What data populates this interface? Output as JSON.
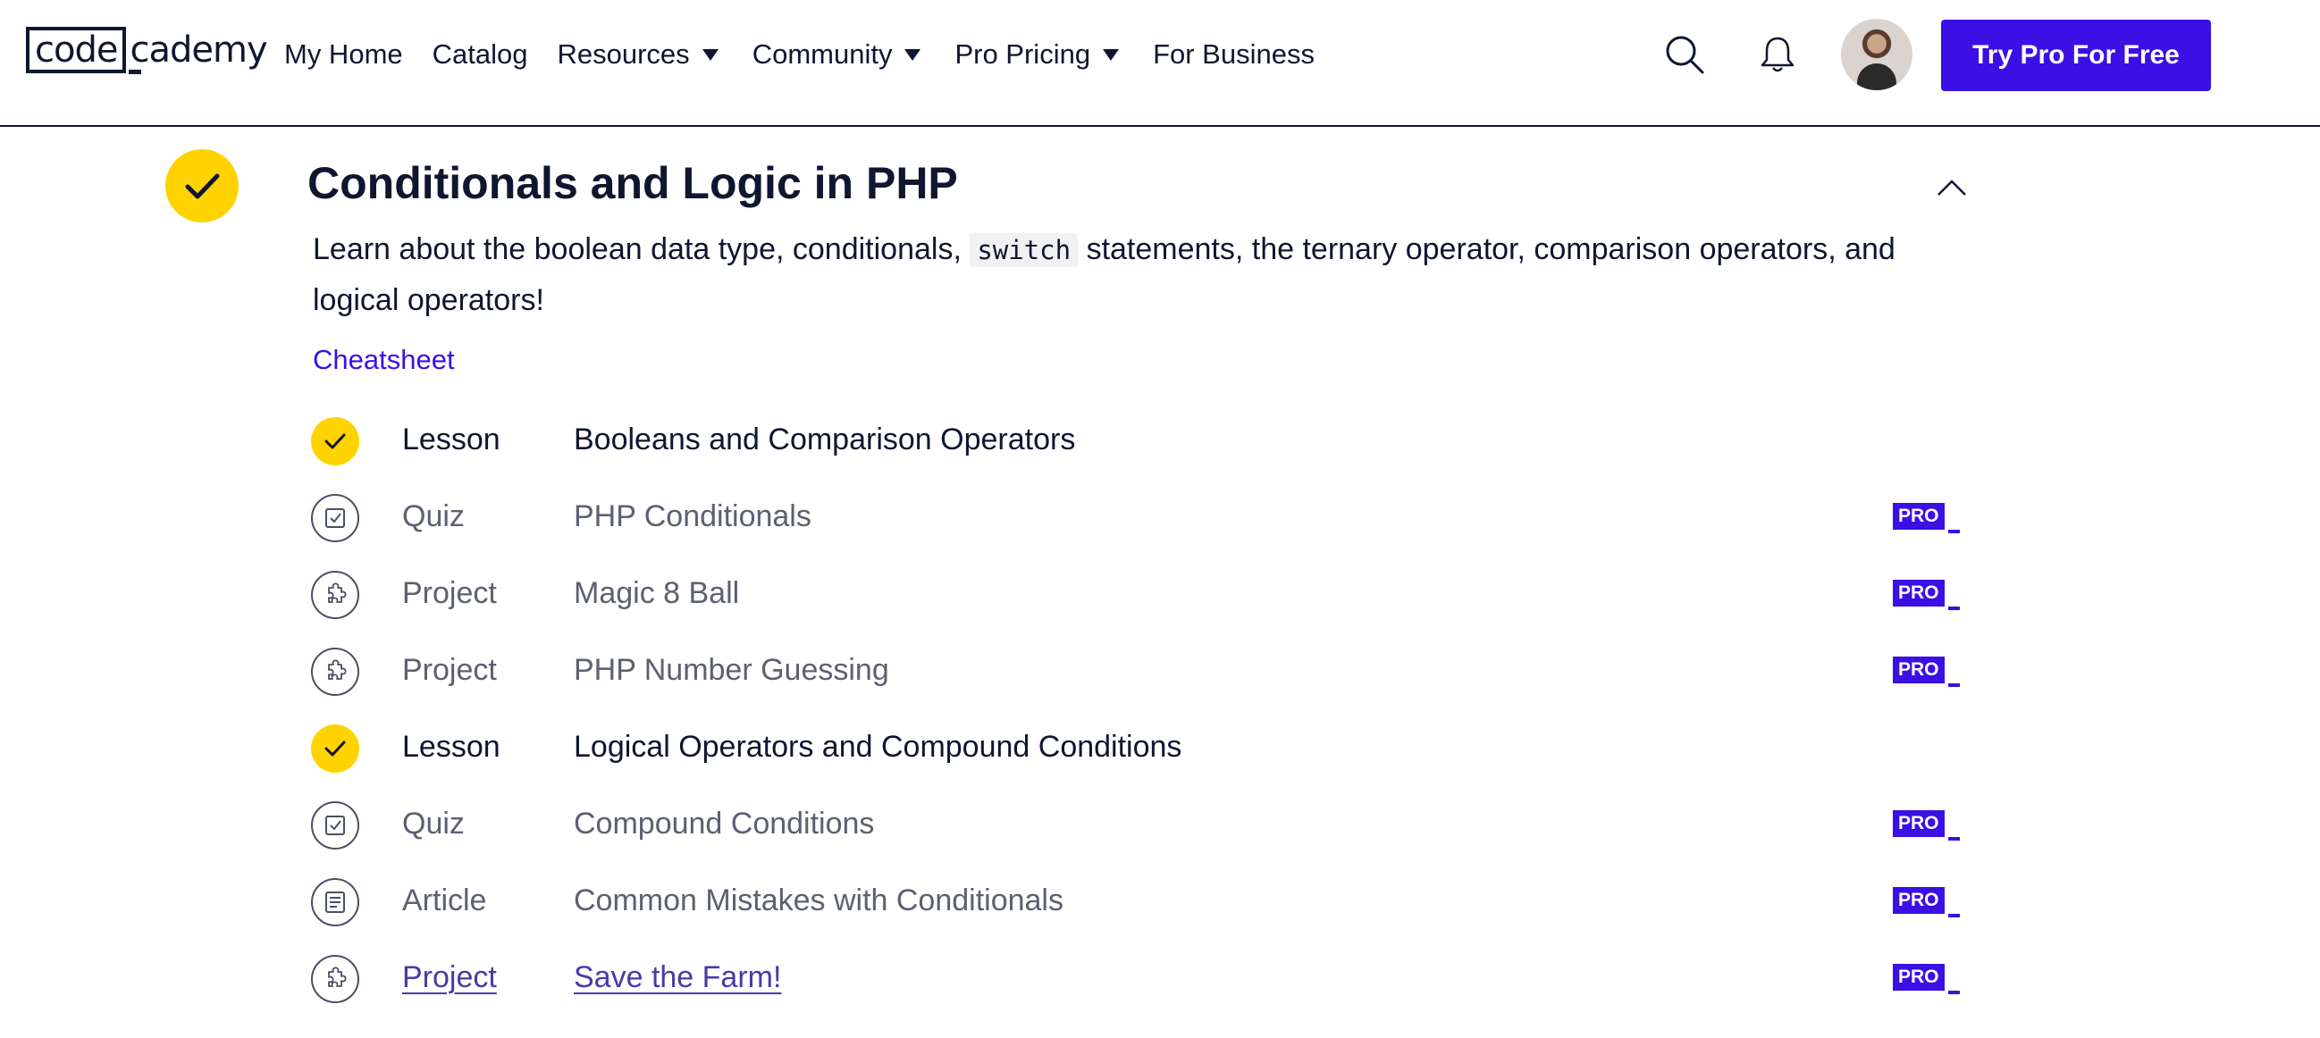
{
  "header": {
    "logo_boxed": "code",
    "logo_rest": "cademy",
    "nav": [
      {
        "label": "My Home",
        "dropdown": false
      },
      {
        "label": "Catalog",
        "dropdown": false
      },
      {
        "label": "Resources",
        "dropdown": true
      },
      {
        "label": "Community",
        "dropdown": true
      },
      {
        "label": "Pro Pricing",
        "dropdown": true
      },
      {
        "label": "For Business",
        "dropdown": false
      }
    ],
    "icons": [
      "search-icon",
      "bell-icon"
    ],
    "cta_label": "Try Pro For Free"
  },
  "module": {
    "title": "Conditionals and Logic in PHP",
    "completed": true,
    "description_before": "Learn about the boolean data type, conditionals,",
    "description_code": "switch",
    "description_after": "statements, the ternary operator, comparison operators, and logical operators!",
    "cheatsheet_label": "Cheatsheet",
    "items": [
      {
        "type": "Lesson",
        "name": "Booleans and Comparison Operators",
        "status": "done",
        "icon": "check-icon",
        "pro": false
      },
      {
        "type": "Quiz",
        "name": "PHP Conditionals",
        "status": "locked",
        "icon": "quiz-icon",
        "pro": true
      },
      {
        "type": "Project",
        "name": "Magic 8 Ball",
        "status": "locked",
        "icon": "puzzle-icon",
        "pro": true
      },
      {
        "type": "Project",
        "name": "PHP Number Guessing",
        "status": "locked",
        "icon": "puzzle-icon",
        "pro": true
      },
      {
        "type": "Lesson",
        "name": "Logical Operators and Compound Conditions",
        "status": "done",
        "icon": "check-icon",
        "pro": false
      },
      {
        "type": "Quiz",
        "name": "Compound Conditions",
        "status": "locked",
        "icon": "quiz-icon",
        "pro": true
      },
      {
        "type": "Article",
        "name": "Common Mistakes with Conditionals",
        "status": "locked",
        "icon": "article-icon",
        "pro": true
      },
      {
        "type": "Project",
        "name": "Save the Farm!",
        "status": "link",
        "icon": "puzzle-icon",
        "pro": true
      }
    ],
    "pro_label": "PRO"
  },
  "colors": {
    "brand": "#3a10e5",
    "complete": "#ffd300",
    "text": "#10162f",
    "muted": "#5d6071"
  }
}
